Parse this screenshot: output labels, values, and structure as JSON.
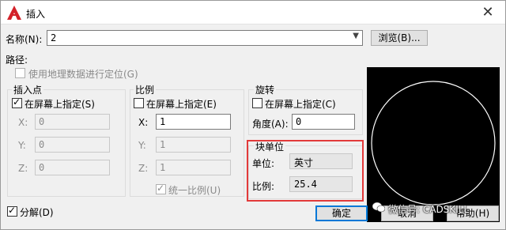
{
  "window": {
    "title": "插入",
    "close_glyph": "✕"
  },
  "name_row": {
    "label": "名称(N):",
    "value": "2",
    "browse_label": "浏览(B)..."
  },
  "path": {
    "label": "路径:",
    "geo_label": "使用地理数据进行定位(G)"
  },
  "insertion": {
    "title": "插入点",
    "specify_label": "在屏幕上指定(S)",
    "x_label": "X:",
    "x_value": "0",
    "y_label": "Y:",
    "y_value": "0",
    "z_label": "Z:",
    "z_value": "0"
  },
  "scale": {
    "title": "比例",
    "specify_label": "在屏幕上指定(E)",
    "x_label": "X:",
    "x_value": "1",
    "y_label": "Y:",
    "y_value": "1",
    "z_label": "Z:",
    "z_value": "1",
    "uniform_label": "统一比例(U)"
  },
  "rotation": {
    "title": "旋转",
    "specify_label": "在屏幕上指定(C)",
    "angle_label": "角度(A):",
    "angle_value": "0"
  },
  "block_unit": {
    "title": "块单位",
    "unit_label": "单位:",
    "unit_value": "英寸",
    "factor_label": "比例:",
    "factor_value": "25.4"
  },
  "explode": {
    "label": "分解(D)"
  },
  "buttons": {
    "ok": "确定",
    "cancel": "取消",
    "help": "帮助(H)"
  },
  "watermark": {
    "text": "微信号: CADSKILL"
  },
  "colors": {
    "highlight": "#e23a3a",
    "accent": "#0078d7"
  }
}
